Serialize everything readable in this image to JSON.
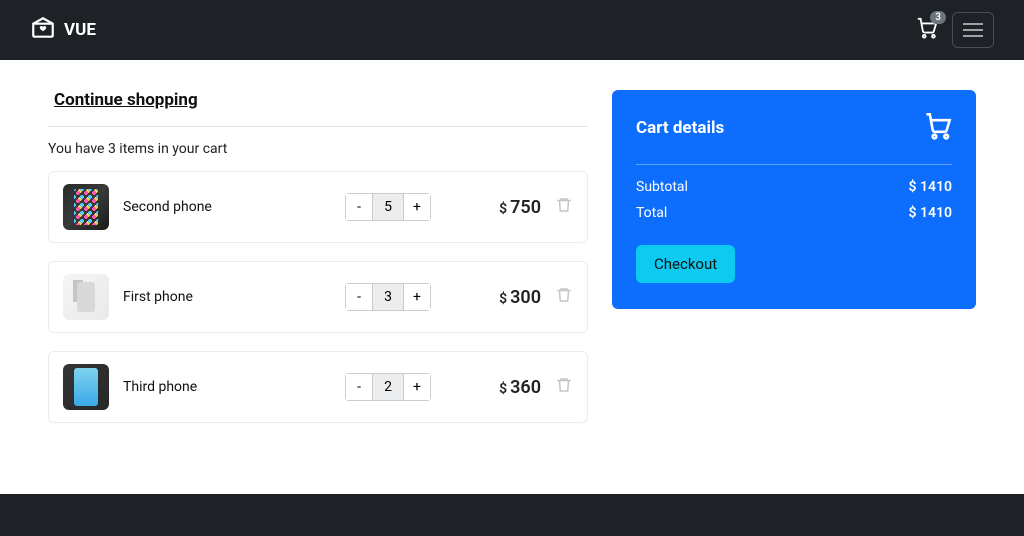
{
  "brand": "VUE",
  "nav_cart_count": "3",
  "back_label": "Continue shopping",
  "summary_text": "You have 3 items in your cart",
  "currency": "$",
  "items": [
    {
      "name": "Second phone",
      "qty": "5",
      "price": "750"
    },
    {
      "name": "First phone",
      "qty": "3",
      "price": "300"
    },
    {
      "name": "Third phone",
      "qty": "2",
      "price": "360"
    }
  ],
  "details": {
    "title": "Cart details",
    "rows": [
      {
        "label": "Subtotal",
        "value": "1410"
      },
      {
        "label": "Total",
        "value": "1410"
      }
    ],
    "checkout_label": "Checkout"
  }
}
